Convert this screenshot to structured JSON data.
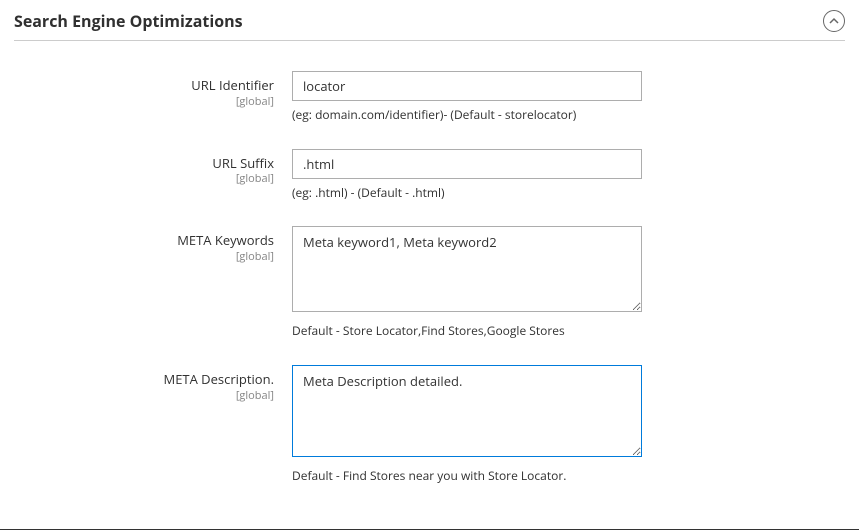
{
  "section": {
    "title": "Search Engine Optimizations"
  },
  "fields": {
    "url_identifier": {
      "label": "URL Identifier",
      "scope": "[global]",
      "value": "locator",
      "hint": "(eg: domain.com/identifier)- (Default - storelocator)"
    },
    "url_suffix": {
      "label": "URL Suffix",
      "scope": "[global]",
      "value": ".html",
      "hint": "(eg: .html) - (Default - .html)"
    },
    "meta_keywords": {
      "label": "META Keywords",
      "scope": "[global]",
      "value": "Meta keyword1, Meta keyword2",
      "hint": "Default - Store Locator,Find Stores,Google Stores"
    },
    "meta_description": {
      "label": "META Description.",
      "scope": "[global]",
      "value": "Meta Description detailed.",
      "hint": "Default - Find Stores near you with Store Locator."
    }
  }
}
